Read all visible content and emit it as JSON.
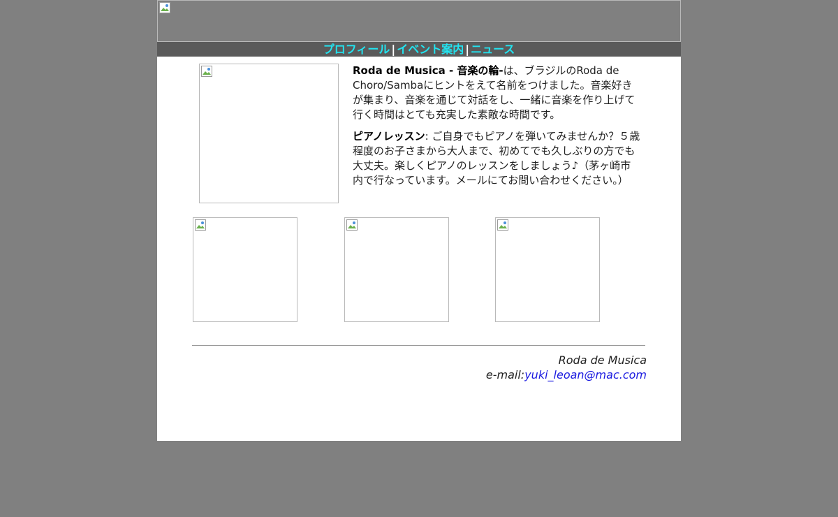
{
  "nav": {
    "items": [
      {
        "label": "プロフィール"
      },
      {
        "label": "イベント案内"
      },
      {
        "label": "ニュース"
      }
    ],
    "separator": "|",
    "link_color": "#22e4f0"
  },
  "intro": {
    "title_bold": "Roda de Musica - 音楽の輪-",
    "body": "は、ブラジルのRoda de Choro/Sambaにヒントをえて名前をつけました。音楽好きが集まり、音楽を通じて対話をし、一緒に音楽を作り上げて行く時間はとても充実した素敵な時間です。"
  },
  "lesson": {
    "title_bold": "ピアノレッスン",
    "body": ":  ご自身でもピアノを弾いてみませんか？５歳程度のお子さまから大人まで、初めてでも久しぶりの方でも大丈夫。楽しくピアノのレッスンをしましょう♪（茅ヶ崎市内で行なっています。メールにてお問い合わせください。）"
  },
  "footer": {
    "name": "Roda de Musica",
    "email_label": "e-mail:",
    "email": "yuki_leoan@mac.com"
  },
  "icons": {
    "broken_image": "broken-image-icon"
  },
  "colors": {
    "page_bg": "#808080",
    "content_bg": "#ffffff",
    "nav_bg": "#5a5a5a",
    "email_link": "#1a1ae0"
  }
}
